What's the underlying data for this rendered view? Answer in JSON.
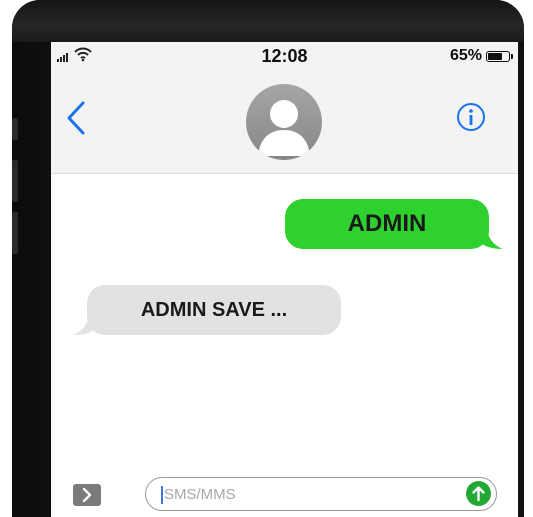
{
  "status_bar": {
    "time": "12:08",
    "battery_percent": "65%",
    "battery_level": 0.65
  },
  "nav_bar": {
    "back_icon": "chevron-left-icon",
    "contact_icon": "person-silhouette",
    "info_icon": "info-circle-icon",
    "accent_color": "#1a73e8"
  },
  "messages": [
    {
      "direction": "outgoing",
      "text": "ADMIN",
      "bubble_color": "#2fd12f"
    },
    {
      "direction": "incoming",
      "text": "ADMIN SAVE ...",
      "bubble_color": "#e2e2e2"
    }
  ],
  "composer": {
    "placeholder": "SMS/MMS",
    "expand_icon": "chevron-right-icon",
    "send_icon": "arrow-up-icon",
    "send_color": "#22a833"
  }
}
